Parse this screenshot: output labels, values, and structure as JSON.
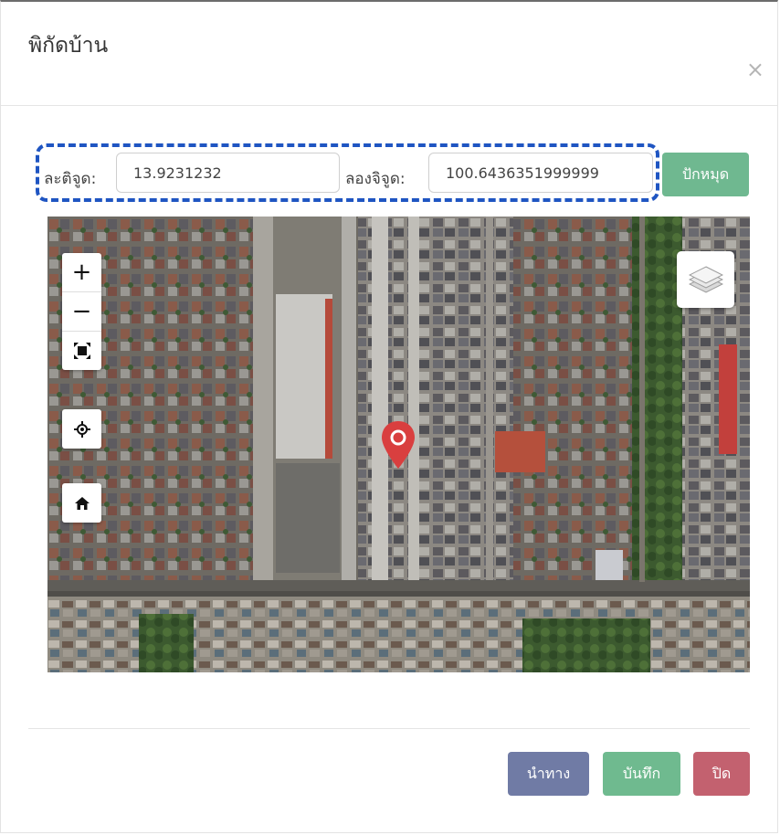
{
  "modal": {
    "title": "พิกัดบ้าน",
    "close_label": "×"
  },
  "coords": {
    "latitude_label": "ละติจูด:",
    "latitude_value": "13.9231232",
    "longitude_label": "ลองจิจูด:",
    "longitude_value": "100.6436351999999",
    "pin_button": "ปักหมุด"
  },
  "map": {
    "zoom_in": "+",
    "zoom_out": "−",
    "icons": [
      "zoom-in-icon",
      "zoom-out-icon",
      "fit-extent-icon",
      "locate-icon",
      "home-icon",
      "layers-icon",
      "map-pin-icon"
    ]
  },
  "footer": {
    "navigate_label": "นำทาง",
    "save_label": "บันทึก",
    "close_label": "ปิด"
  },
  "colors": {
    "pin_button": "#6fb890",
    "navigate": "#707ba5",
    "save": "#6fba8f",
    "close": "#c3616f",
    "dashed_outline": "#1f55c2",
    "marker": "#d93f3f"
  }
}
